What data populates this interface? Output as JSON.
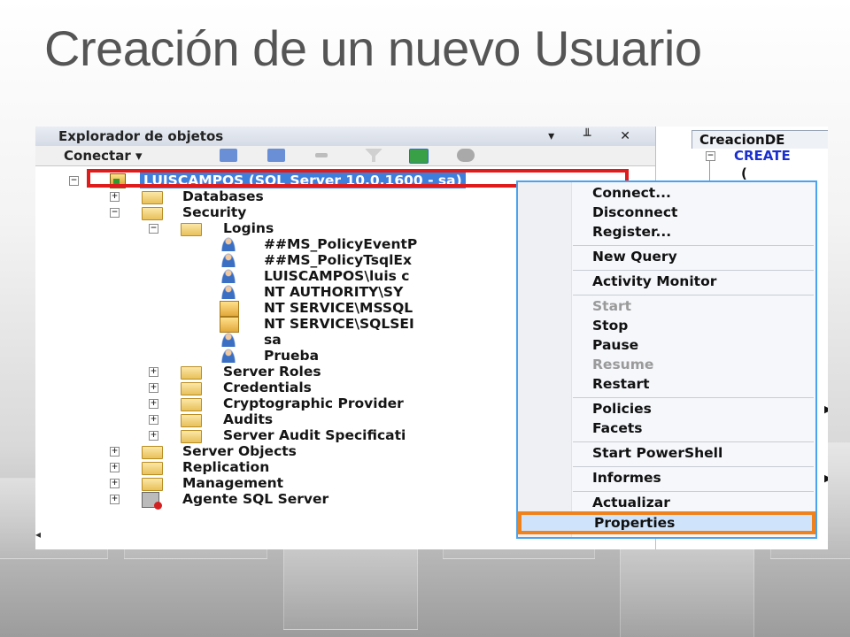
{
  "slide": {
    "title": "Creación de un nuevo Usuario"
  },
  "object_explorer": {
    "title": "Explorador de objetos",
    "controls": "▾ ╨ ✕",
    "toolbar": {
      "connect_label": "Conectar ▾"
    },
    "tree": {
      "server": "LUISCAMPOS (SQL Server 10.0.1600 - sa)",
      "databases": "Databases",
      "security": "Security",
      "logins": "Logins",
      "login_items": [
        "##MS_PolicyEventP",
        "##MS_PolicyTsqlEx",
        "LUISCAMPOS\\luis c",
        "NT AUTHORITY\\SY",
        "NT SERVICE\\MSSQL",
        "NT SERVICE\\SQLSEI",
        "sa",
        "Prueba"
      ],
      "security_children": [
        "Server Roles",
        "Credentials",
        "Cryptographic Provider",
        "Audits",
        "Server Audit Specificati"
      ],
      "server_children": [
        "Server Objects",
        "Replication",
        "Management",
        "Agente SQL Server"
      ]
    }
  },
  "editor": {
    "tab": "CreacionDE",
    "lines": [
      "CREATE",
      "("
    ]
  },
  "context_menu": {
    "items": [
      "Connect...",
      "Disconnect",
      "Register...",
      "New Query",
      "Activity Monitor",
      "Start",
      "Stop",
      "Pause",
      "Resume",
      "Restart",
      "Policies",
      "Facets",
      "Start PowerShell",
      "Informes",
      "Actualizar",
      "Properties"
    ],
    "disabled": [
      "Start",
      "Resume"
    ],
    "highlighted": "Properties"
  },
  "colors": {
    "selection_box": "#e01b1b",
    "highlight_box": "#f0821e",
    "menu_border": "#4aa3ee",
    "title_text": "#555555"
  }
}
